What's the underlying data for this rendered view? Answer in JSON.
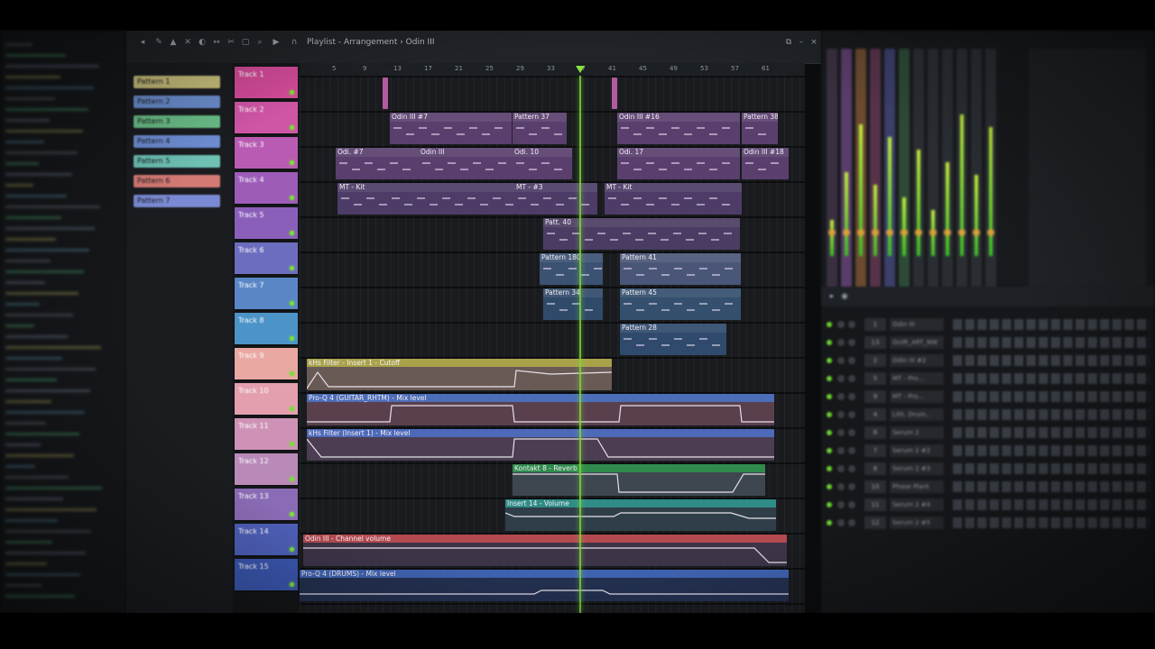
{
  "colors": {
    "accent_green": "#7fd63a",
    "track_pink": "#d9559c",
    "track_purple": "#a35bbd",
    "track_blue": "#5d86c8",
    "clip_purple": "#5a3f6e",
    "clip_blue": "#3b5272",
    "auto_yellow": "#a9a24a",
    "auto_blue": "#4c6db7",
    "auto_green": "#2f8a4c",
    "auto_teal": "#2f8c87",
    "auto_red": "#b24a4f"
  },
  "toolbar": {
    "title": "Playlist - Arrangement › Odin III"
  },
  "timeline": {
    "ticks": [
      "5",
      "9",
      "13",
      "17",
      "21",
      "25",
      "29",
      "33",
      "37",
      "41",
      "45",
      "49",
      "53",
      "57",
      "61"
    ]
  },
  "tracks": [
    {
      "name": "Track 1",
      "color": "#d24a98"
    },
    {
      "name": "Track 2",
      "color": "#cf55a5"
    },
    {
      "name": "Track 3",
      "color": "#b95bb2"
    },
    {
      "name": "Track 4",
      "color": "#9d5cb8"
    },
    {
      "name": "Track 5",
      "color": "#8a5fba"
    },
    {
      "name": "Track 6",
      "color": "#6d6dbf"
    },
    {
      "name": "Track 7",
      "color": "#5a86c6"
    },
    {
      "name": "Track 8",
      "color": "#4c93c8"
    },
    {
      "name": "Track 9",
      "color": "#e9a8a2"
    },
    {
      "name": "Track 10",
      "color": "#e49fae"
    },
    {
      "name": "Track 11",
      "color": "#cf92b7"
    },
    {
      "name": "Track 12",
      "color": "#b98ab8"
    },
    {
      "name": "Track 13",
      "color": "#8a6bb5"
    },
    {
      "name": "Track 14",
      "color": "#4e5fb8"
    },
    {
      "name": "Track 15",
      "color": "#3b57b0"
    }
  ],
  "clips": [
    {
      "track": 1,
      "label": "Odin III #7"
    },
    {
      "track": 1,
      "label": "Pattern 37"
    },
    {
      "track": 1,
      "label": "Odin III #16"
    },
    {
      "track": 1,
      "label": "Pattern 38"
    },
    {
      "track": 2,
      "label": "Odi. #7"
    },
    {
      "track": 2,
      "label": "Odin III"
    },
    {
      "track": 2,
      "label": "Odi. 10"
    },
    {
      "track": 2,
      "label": "Odi. 17"
    },
    {
      "track": 2,
      "label": "Odin III #18"
    },
    {
      "track": 3,
      "label": "MT - Kit"
    },
    {
      "track": 3,
      "label": "MT - #3"
    },
    {
      "track": 3,
      "label": "MT - Kit"
    },
    {
      "track": 4,
      "label": "Patt. 40"
    },
    {
      "track": 5,
      "label": "Pattern 180"
    },
    {
      "track": 5,
      "label": "Pattern 41"
    },
    {
      "track": 6,
      "label": "Pattern 34"
    },
    {
      "track": 6,
      "label": "Pattern 45"
    },
    {
      "track": 7,
      "label": "Pattern 28"
    }
  ],
  "automation": [
    {
      "label": "kHs Filter - Insert 1 - Cutoff"
    },
    {
      "label": "Pro-Q 4 (GUITAR_RHTM) - Mix level"
    },
    {
      "label": "kHs Filter (Insert 1) - Mix level"
    },
    {
      "label": "Kontakt 8 - Reverb"
    },
    {
      "label": "Insert 14 - Volume"
    },
    {
      "label": "Odin III - Channel volume"
    },
    {
      "label": "Pro-Q 4 (DRUMS) - Mix level"
    }
  ],
  "pattern_picker": [
    {
      "label": "Pattern 1",
      "color": "#c9c07b"
    },
    {
      "label": "Pattern 2",
      "color": "#6c8fd0"
    },
    {
      "label": "Pattern 3",
      "color": "#6bbf88"
    },
    {
      "label": "Pattern 4",
      "color": "#6f8fd6"
    },
    {
      "label": "Pattern 5",
      "color": "#6ec2b5"
    },
    {
      "label": "Pattern 6",
      "color": "#d47a75"
    },
    {
      "label": "Pattern 7",
      "color": "#7b8ad4"
    }
  ],
  "rack": {
    "rows": [
      {
        "num": "1",
        "name": "Odin III"
      },
      {
        "num": "13",
        "name": "GUIR_ART_NW"
      },
      {
        "num": "2",
        "name": "Odin III #2"
      },
      {
        "num": "5",
        "name": "MT - Pro..."
      },
      {
        "num": "9",
        "name": "MT - Pro..."
      },
      {
        "num": "4",
        "name": "Lith. Drum.."
      },
      {
        "num": "6",
        "name": "Serum 2"
      },
      {
        "num": "7",
        "name": "Serum 2 #2"
      },
      {
        "num": "8",
        "name": "Serum 2 #3"
      },
      {
        "num": "10",
        "name": "Phase Plant"
      },
      {
        "num": "11",
        "name": "Serum 2 #4"
      },
      {
        "num": "12",
        "name": "Serum 2 #5"
      }
    ]
  }
}
